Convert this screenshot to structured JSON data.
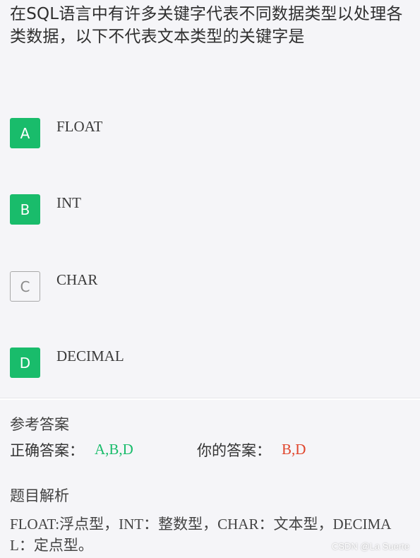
{
  "question": {
    "text": "在SQL语言中有许多关键字代表不同数据类型以处理各类数据，以下不代表文本类型的关键字是"
  },
  "options": [
    {
      "letter": "A",
      "text": "FLOAT",
      "selected": true
    },
    {
      "letter": "B",
      "text": "INT",
      "selected": true
    },
    {
      "letter": "C",
      "text": "CHAR",
      "selected": false
    },
    {
      "letter": "D",
      "text": "DECIMAL",
      "selected": true
    }
  ],
  "reference": {
    "title": "参考答案",
    "correct_label": "正确答案：",
    "correct_value": "A,B,D",
    "user_label": "你的答案：",
    "user_value": "B,D"
  },
  "analysis": {
    "title": "题目解析",
    "text": "FLOAT:浮点型，INT：整数型，CHAR：文本型，DECIMAL：定点型。"
  },
  "watermark": "CSDN @La Suerte",
  "colors": {
    "selected_green": "#19bc6b",
    "wrong_red": "#e0452c",
    "background": "#f5f5f8"
  }
}
